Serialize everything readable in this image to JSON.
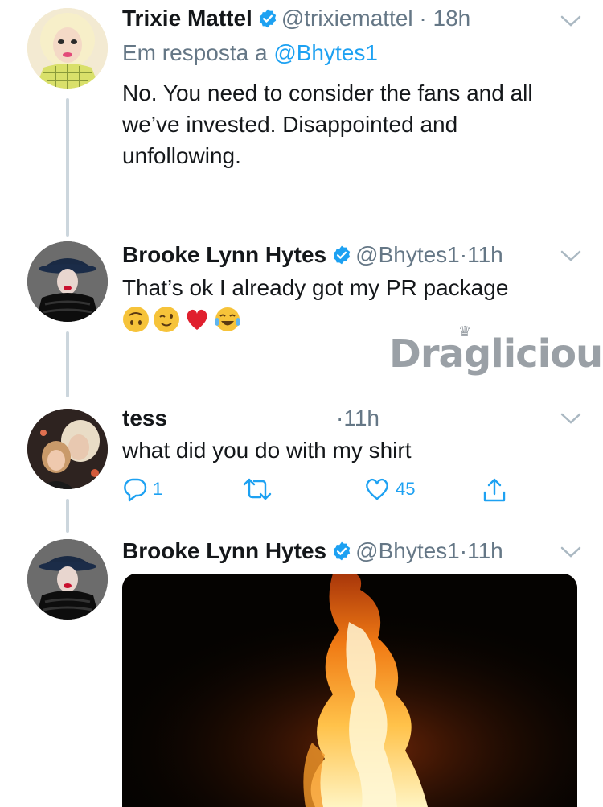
{
  "tweets": [
    {
      "name": "Trixie Mattel",
      "handle": "@trixiemattel",
      "separator": "·",
      "time": "18h",
      "reply_prefix": "Em resposta a",
      "reply_mention": "@Bhytes1",
      "text": "No. You need to consider the fans and all we’ve invested. Disappointed and unfollowing."
    },
    {
      "name": "Brooke Lynn Hytes",
      "handle": "@Bhytes1",
      "separator": "·",
      "time": "11h",
      "text": "That’s ok I already got my PR package",
      "emojis": [
        "upside-down-face",
        "winking-face",
        "red-heart",
        "tears-of-joy-face"
      ]
    },
    {
      "name": "tess",
      "separator": "·",
      "time": "11h",
      "text": "what did you do with my shirt",
      "reply_count": "1",
      "like_count": "45"
    },
    {
      "name": "Brooke Lynn Hytes",
      "handle": "@Bhytes1",
      "separator": "·",
      "time": "11h",
      "media": "fire-video"
    }
  ],
  "watermark": "Draglicious",
  "colors": {
    "link": "#1da1f2",
    "secondary_text": "#657786",
    "thread_line": "#ccd6dd",
    "verified": "#1da1f2"
  }
}
